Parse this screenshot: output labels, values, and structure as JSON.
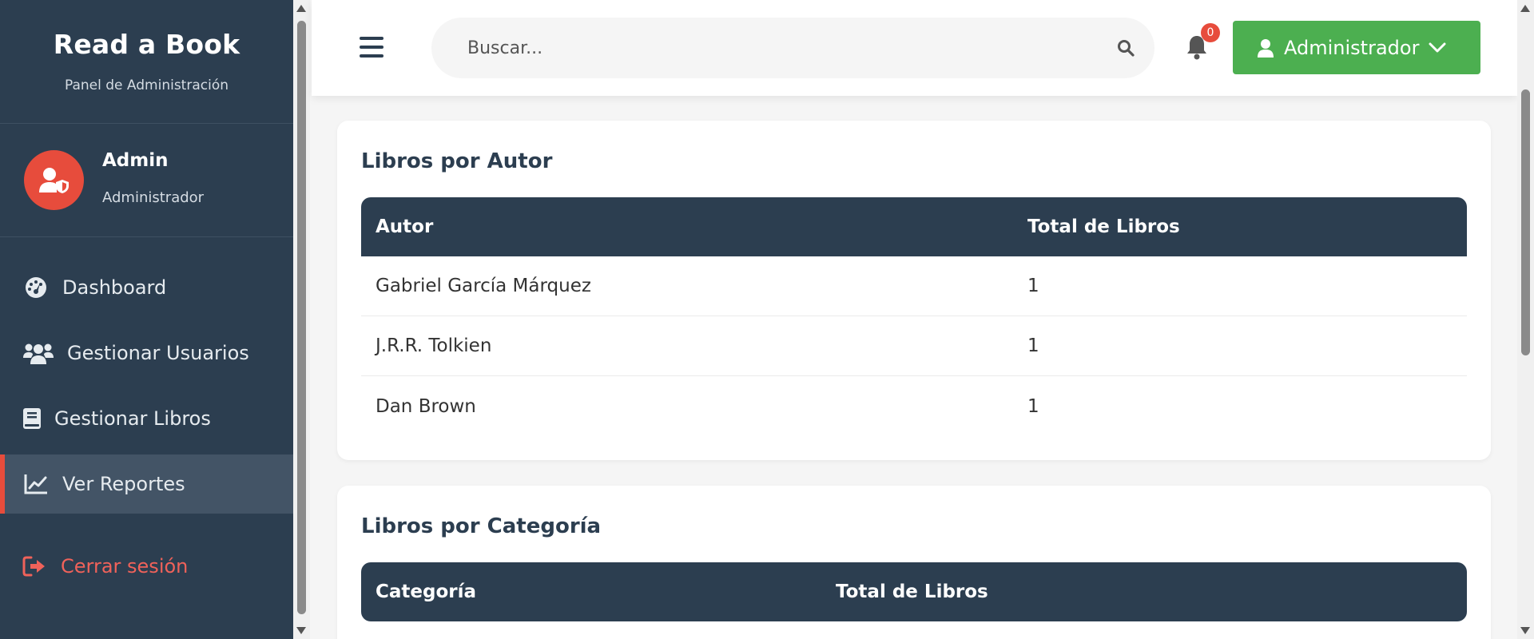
{
  "sidebar": {
    "brand_title": "Read a Book",
    "brand_subtitle": "Panel de Administración",
    "profile": {
      "name": "Admin",
      "role": "Administrador"
    },
    "nav": [
      {
        "label": "Dashboard",
        "icon": "dashboard-icon",
        "active": false
      },
      {
        "label": "Gestionar Usuarios",
        "icon": "users-icon",
        "active": false
      },
      {
        "label": "Gestionar Libros",
        "icon": "book-icon",
        "active": false
      },
      {
        "label": "Ver Reportes",
        "icon": "chart-line-icon",
        "active": true
      }
    ],
    "logout_label": "Cerrar sesión"
  },
  "header": {
    "search_placeholder": "Buscar...",
    "notification_count": "0",
    "user_button_label": "Administrador"
  },
  "reports": {
    "authors": {
      "title": "Libros por Autor",
      "columns": [
        "Autor",
        "Total de Libros"
      ],
      "rows": [
        [
          "Gabriel García Márquez",
          "1"
        ],
        [
          "J.R.R. Tolkien",
          "1"
        ],
        [
          "Dan Brown",
          "1"
        ]
      ]
    },
    "categories": {
      "title": "Libros por Categoría",
      "columns": [
        "Categoría",
        "Total de Libros"
      ]
    }
  },
  "colors": {
    "sidebar_bg": "#2c3e50",
    "accent_red": "#e74c3c",
    "button_green": "#4caf50",
    "table_header_bg": "#2c3e50"
  }
}
